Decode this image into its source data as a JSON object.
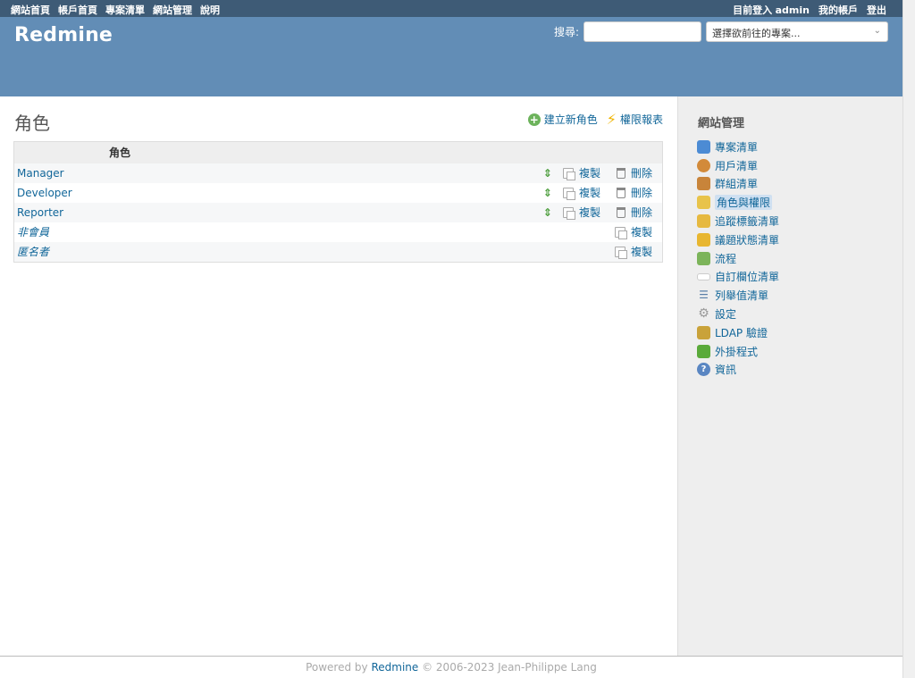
{
  "top_menu": {
    "left": [
      "網站首頁",
      "帳戶首頁",
      "專案清單",
      "網站管理",
      "說明"
    ],
    "logged_as_prefix": "目前登入",
    "username": "admin",
    "my_account": "我的帳戶",
    "logout": "登出"
  },
  "header": {
    "title": "Redmine",
    "search_label": "搜尋:",
    "search_value": "",
    "jump_placeholder": "選擇欲前往的專案..."
  },
  "main": {
    "title": "角色",
    "new_role": "建立新角色",
    "permissions_report": "權限報表",
    "table": {
      "header": "角色",
      "rows": [
        {
          "name": "Manager",
          "builtin": false,
          "copy": "複製",
          "delete": "刪除"
        },
        {
          "name": "Developer",
          "builtin": false,
          "copy": "複製",
          "delete": "刪除"
        },
        {
          "name": "Reporter",
          "builtin": false,
          "copy": "複製",
          "delete": "刪除"
        },
        {
          "name": "非會員",
          "builtin": true,
          "copy": "複製"
        },
        {
          "name": "匿名者",
          "builtin": true,
          "copy": "複製"
        }
      ]
    }
  },
  "sidebar": {
    "title": "網站管理",
    "items": [
      {
        "label": "專案清單",
        "icon": "projects-icon",
        "color": "#4c8bd4"
      },
      {
        "label": "用戶清單",
        "icon": "user-icon",
        "color": "#d28a3a"
      },
      {
        "label": "群組清單",
        "icon": "group-icon",
        "color": "#c8843a"
      },
      {
        "label": "角色與權限",
        "icon": "roles-icon",
        "color": "#e8c34a",
        "selected": true
      },
      {
        "label": "追蹤標籤清單",
        "icon": "trackers-icon",
        "color": "#e6b940"
      },
      {
        "label": "議題狀態清單",
        "icon": "issue-status-icon",
        "color": "#e8b630"
      },
      {
        "label": "流程",
        "icon": "workflow-icon",
        "color": "#7cb45a"
      },
      {
        "label": "自訂欄位清單",
        "icon": "custom-fields-icon",
        "color": "#ffffff"
      },
      {
        "label": "列舉值清單",
        "icon": "enumerations-icon",
        "color": "#5a7fa8"
      },
      {
        "label": "設定",
        "icon": "settings-icon",
        "color": "#a0a0a0"
      },
      {
        "label": "LDAP 驗證",
        "icon": "ldap-icon",
        "color": "#c9a23a"
      },
      {
        "label": "外掛程式",
        "icon": "plugins-icon",
        "color": "#5aaa3a"
      },
      {
        "label": "資訊",
        "icon": "info-icon",
        "color": "#5a86c2"
      }
    ]
  },
  "footer": {
    "prefix": "Powered by",
    "link": "Redmine",
    "suffix": "© 2006-2023 Jean-Philippe Lang"
  }
}
